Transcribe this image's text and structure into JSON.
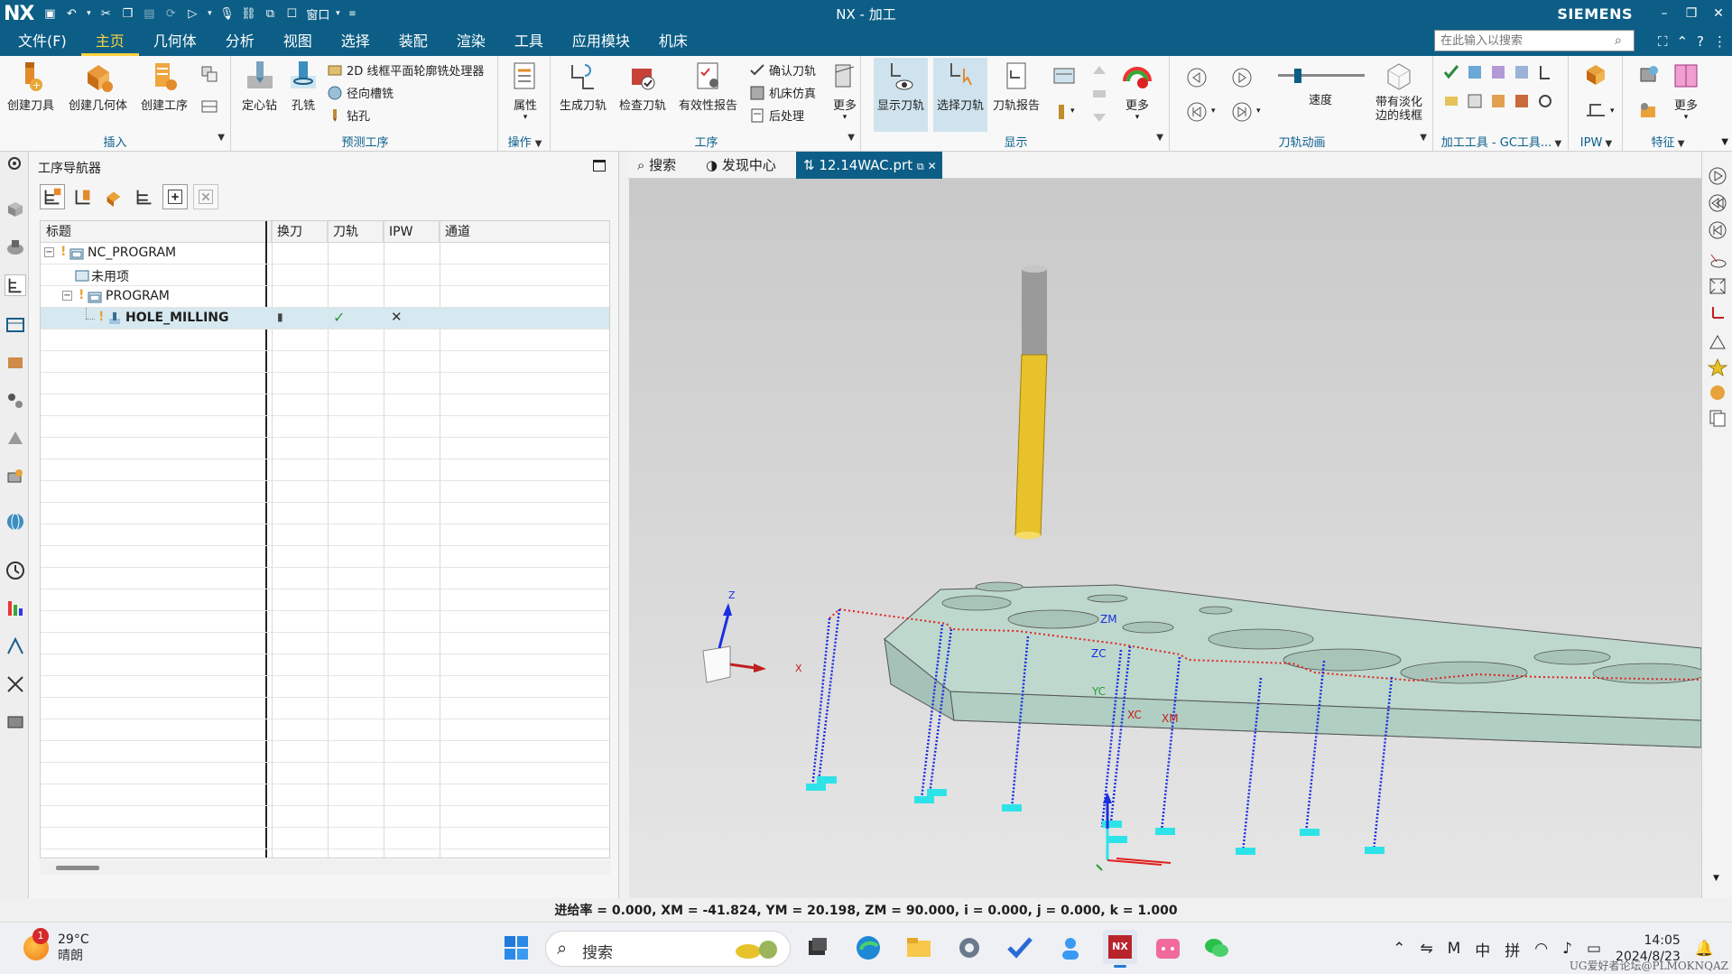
{
  "app": {
    "logo": "NX",
    "title": "NX - 加工",
    "brand": "SIEMENS",
    "window_menu": "窗口"
  },
  "menu": {
    "items": [
      "文件(F)",
      "主页",
      "几何体",
      "分析",
      "视图",
      "选择",
      "装配",
      "渲染",
      "工具",
      "应用模块",
      "机床"
    ],
    "active": "主页",
    "search_placeholder": "在此输入以搜索"
  },
  "ribbon": {
    "insert": {
      "label": "插入",
      "create_tool": "创建刀具",
      "create_geometry": "创建几何体",
      "create_operation": "创建工序"
    },
    "predict": {
      "label": "预测工序",
      "center_drill": "定心钻",
      "hole_milling": "孔铣",
      "planar_profile": "2D 线框平面轮廓铣处理器",
      "radial_groove": "径向槽铣",
      "drilling": "钻孔"
    },
    "operation": {
      "label": "操作",
      "properties": "属性"
    },
    "process": {
      "label": "工序",
      "generate": "生成刀轨",
      "verify": "检查刀轨",
      "validity_report": "有效性报告",
      "confirm_path": "确认刀轨",
      "machine_sim": "机床仿真",
      "postprocess": "后处理",
      "more": "更多"
    },
    "display": {
      "label": "显示",
      "show_path": "显示刀轨",
      "select_path": "选择刀轨",
      "path_report": "刀轨报告",
      "more": "更多"
    },
    "animation": {
      "label": "刀轨动画",
      "speed": "速度",
      "speed_level": 0.2,
      "faded_wireframe": "带有淡化边的线框"
    },
    "gc": {
      "label": "加工工具 - GC工具..."
    },
    "ipw": {
      "label": "IPW"
    },
    "feature": {
      "label": "特征",
      "more": "更多"
    }
  },
  "navigator": {
    "title": "工序导航器",
    "columns": [
      "标题",
      "换刀",
      "刀轨",
      "IPW",
      "通道"
    ],
    "rows": [
      {
        "name": "NC_PROGRAM",
        "indent": 0
      },
      {
        "name": "未用项",
        "indent": 1
      },
      {
        "name": "PROGRAM",
        "indent": 1
      },
      {
        "name": "HOLE_MILLING",
        "indent": 2,
        "tool_change": "▮",
        "path_ok": "✓",
        "ipw": "✕"
      }
    ]
  },
  "tabs": {
    "search": "搜索",
    "discovery": "发现中心",
    "file": "12.14WAC.prt"
  },
  "viewport": {
    "axes": {
      "z": "Z",
      "x": "X",
      "zm": "ZM",
      "zc": "ZC",
      "yc": "YC",
      "xc": "XC",
      "xm": "XM"
    }
  },
  "status": {
    "feedrate": "进给率 = 0.000, XM = -41.824, YM = 20.198, ZM = 90.000, i = 0.000, j = 0.000, k = 1.000"
  },
  "taskbar": {
    "weather_temp": "29°C",
    "weather_desc": "晴朗",
    "notification_count": "1",
    "search_text": "搜索",
    "ime_mode": "中",
    "ime_layout": "拼",
    "time": "14:05",
    "date": "2024/8/23",
    "watermark": "UG爱好者论坛@PLMOKNQAZ"
  },
  "colors": {
    "titlebar": "#0c5e86",
    "menu_active": "#ffd33f",
    "group_label": "#0b5f8c",
    "selection_row": "#d6e8f0",
    "toolpath_red": "#e02020",
    "toolpath_blue": "#1a2fe0",
    "tool_yellow": "#e8c22a",
    "part_fill": "#b9d3ca"
  }
}
